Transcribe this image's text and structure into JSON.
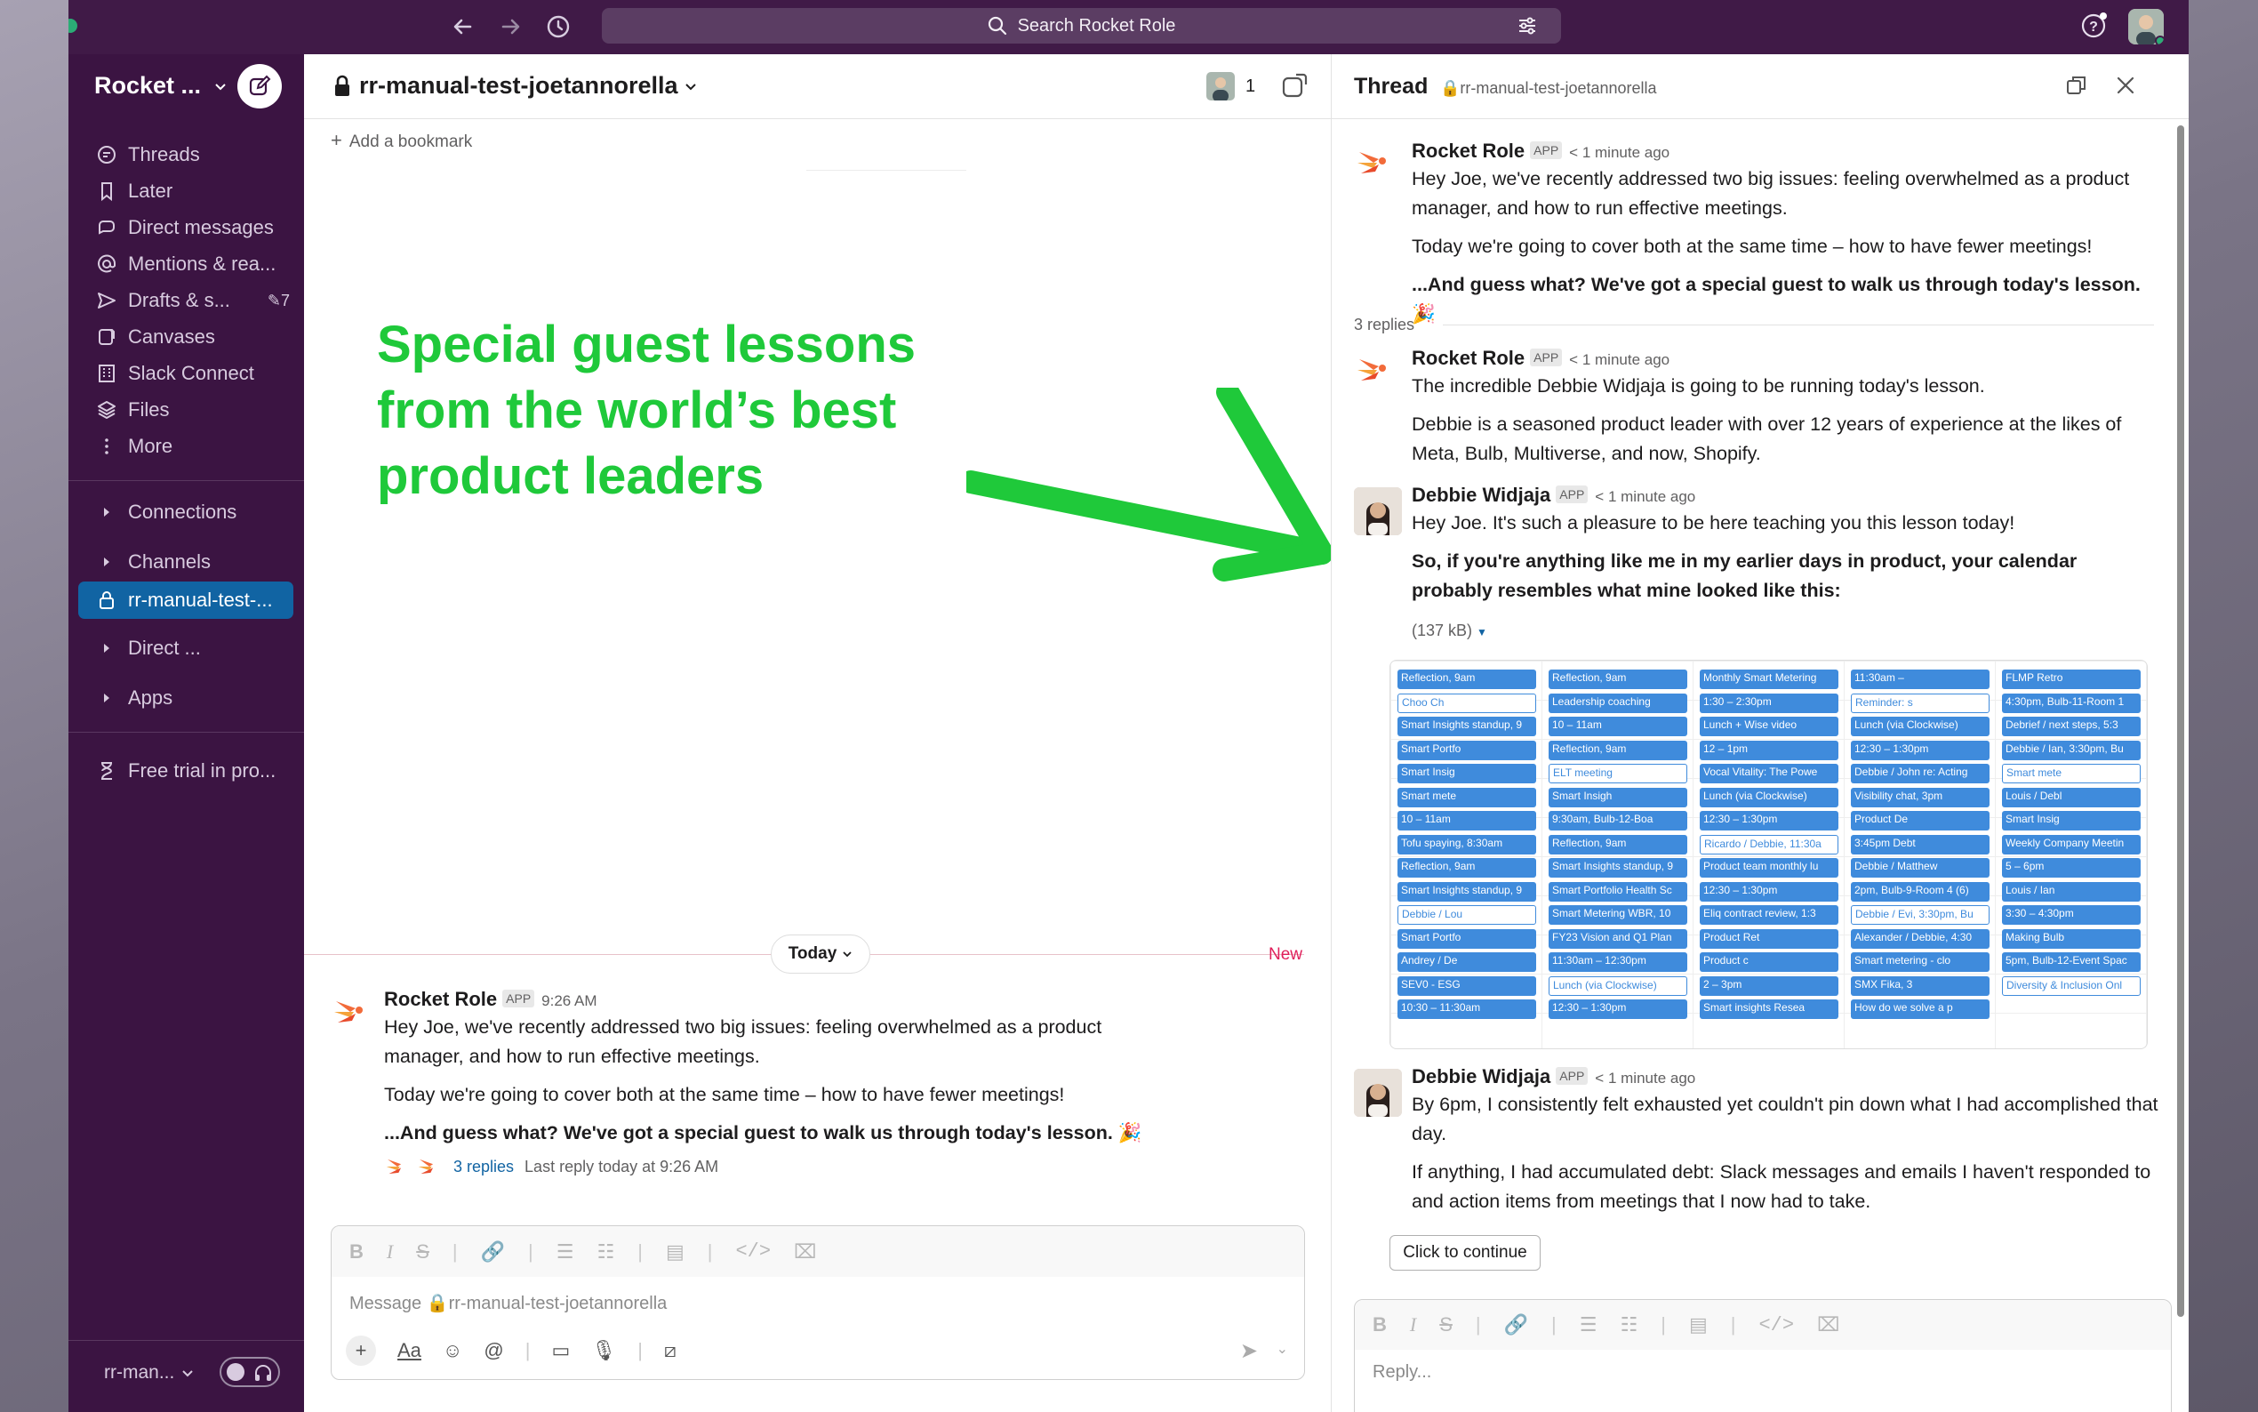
{
  "search": {
    "label": "Search Rocket Role"
  },
  "workspace": {
    "name": "Rocket ..."
  },
  "sidebar": {
    "items": [
      {
        "label": "Threads"
      },
      {
        "label": "Later"
      },
      {
        "label": "Direct messages"
      },
      {
        "label": "Mentions & rea..."
      },
      {
        "label": "Drafts & s...",
        "badge": "7"
      },
      {
        "label": "Canvases"
      },
      {
        "label": "Slack Connect"
      },
      {
        "label": "Files"
      },
      {
        "label": "More"
      }
    ],
    "sections": [
      {
        "label": "Connections"
      },
      {
        "label": "Channels"
      },
      {
        "label": "Direct ..."
      },
      {
        "label": "Apps"
      }
    ],
    "active_channel": "rr-manual-test-...",
    "trial": "Free trial in pro...",
    "bottom_workspace": "rr-man..."
  },
  "channel": {
    "name": "rr-manual-test-joetannorella",
    "member_count": "1",
    "bookmark": "Add a bookmark",
    "promo_lines": [
      "Special guest lessons",
      "from the world’s best",
      "product leaders"
    ],
    "divider_label": "Today",
    "new_label": "New",
    "message": {
      "sender": "Rocket Role",
      "app": "APP",
      "time": "9:26 AM",
      "p1": "Hey Joe, we've recently addressed two big issues: feeling overwhelmed as a product manager, and how to run effective meetings.",
      "p2": "Today we're going to cover both at the same time – how to have fewer meetings!",
      "p3": "...And guess what? We've got a special guest to walk us through today's lesson. 🎉",
      "replies": "3 replies",
      "last_reply": "Last reply today at 9:26 AM"
    },
    "composer_placeholder": "Message 🔒rr-manual-test-joetannorella"
  },
  "thread": {
    "title": "Thread",
    "channel": "rr-manual-test-joetannorella",
    "replies_count": "3 replies",
    "m1": {
      "sender": "Rocket Role",
      "app": "APP",
      "time": "< 1 minute ago",
      "p1": "Hey Joe, we've recently addressed two big issues: feeling overwhelmed as a product manager, and how to run effective meetings.",
      "p2": "Today we're going to cover both at the same time – how to have fewer meetings!",
      "p3": "...And guess what? We've got a special guest to walk us through today's lesson. 🎉"
    },
    "m2": {
      "sender": "Rocket Role",
      "app": "APP",
      "time": "< 1 minute ago",
      "p1": "The incredible Debbie Widjaja is going to be running today's lesson.",
      "p2": "Debbie is a seasoned product leader with over 12 years of experience at the likes of Meta, Bulb, Multiverse, and now, Shopify."
    },
    "m3": {
      "sender": "Debbie Widjaja",
      "app": "APP",
      "time": "< 1 minute ago",
      "p1": "Hey Joe. It's such a pleasure to be here teaching you this lesson today!",
      "p2": "So, if you're anything like me in my earlier days in product, your calendar probably resembles what mine looked like this:",
      "file_size": "(137 kB)"
    },
    "m4": {
      "sender": "Debbie Widjaja",
      "app": "APP",
      "time": "< 1 minute ago",
      "p1": "By 6pm, I consistently felt exhausted yet couldn't pin down what I had accomplished that day.",
      "p2": "If anything, I had accumulated debt: Slack messages and emails I haven't responded to and action items from meetings that I now had to take.",
      "button": "Click to continue"
    },
    "reply_placeholder": "Reply..."
  },
  "calendar_events": [
    "Reflection, 9am",
    "Choo Ch",
    "Smart Insights standup, 9",
    "Smart Portfo",
    "Smart Insig",
    "Smart mete",
    "10 – 11am",
    "Tofu spaying, 8:30am",
    "Reflection, 9am",
    "Smart Insights standup, 9",
    "Debbie / Lou",
    "Smart Portfo",
    "Andrey / De",
    "SEV0 - ESG",
    "10:30 – 11:30am",
    "Reflection, 9am",
    "Leadership coaching",
    "10 – 11am",
    "Reflection, 9am",
    "ELT meeting",
    "Smart Insigh",
    "9:30am, Bulb-12-Boa",
    "Reflection, 9am",
    "Smart Insights standup, 9",
    "Smart Portfolio Health Sc",
    "Smart Metering WBR, 10",
    "FY23 Vision and Q1 Plan",
    "11:30am – 12:30pm",
    "Lunch (via Clockwise)",
    "12:30 – 1:30pm",
    "Monthly Smart Metering",
    "1:30 – 2:30pm",
    "Lunch + Wise video",
    "12 – 1pm",
    "Vocal Vitality: The Powe",
    "Lunch (via Clockwise)",
    "12:30 – 1:30pm",
    "Ricardo / Debbie, 11:30a",
    "Product team monthly lu",
    "12:30 – 1:30pm",
    "Eliq contract review, 1:3",
    "Product Ret",
    "Product c",
    "2 – 3pm",
    "Smart insights Resea",
    "11:30am –",
    "Reminder: s",
    "Lunch (via Clockwise)",
    "12:30 – 1:30pm",
    "Debbie / John re: Acting",
    "Visibility chat, 3pm",
    "Product De",
    "3:45pm Debt",
    "Debbie / Matthew",
    "2pm, Bulb-9-Room 4 (6)",
    "Debbie / Evi, 3:30pm, Bu",
    "Alexander / Debbie, 4:30",
    "Smart metering - clo",
    "SMX Fika, 3",
    "How do we solve a p",
    "FLMP Retro",
    "4:30pm, Bulb-11-Room 1",
    "Debrief / next steps, 5:3",
    "Debbie / Ian, 3:30pm, Bu",
    "Smart mete",
    "Louis / Debl",
    "Smart Insig",
    "Weekly Company Meetin",
    "5 – 6pm",
    "Louis / Ian",
    "3:30 – 4:30pm",
    "Making Bulb",
    "5pm, Bulb-12-Event Spac",
    "Diversity & Inclusion Onl"
  ],
  "colors": {
    "sidebar": "#3b1442",
    "topbar": "#401a47",
    "active": "#1164a3",
    "promo": "#1fc93a",
    "link": "#1264a3",
    "new": "#e01e5a"
  }
}
